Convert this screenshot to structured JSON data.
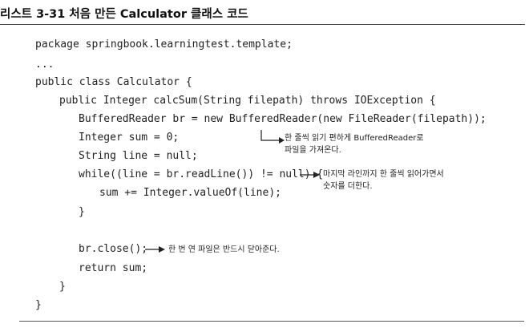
{
  "listing": {
    "title": "리스트 3-31 처음 만든 Calculator 클래스 코드"
  },
  "code": {
    "lines": [
      "package springbook.learningtest.template;",
      "...",
      "public class Calculator {",
      "public Integer calcSum(String filepath) throws IOException {",
      "BufferedReader br = new BufferedReader(new FileReader(filepath));",
      "Integer sum = 0;",
      "String line = null;",
      "while((line = br.readLine()) != null) {",
      "sum += Integer.valueOf(line);",
      "}",
      "br.close();",
      "return sum;",
      "}",
      "}"
    ]
  },
  "annotations": {
    "reader": {
      "line1": "한 줄씩 읽기 편하게 BufferedReader로",
      "line2": "파일을 가져온다."
    },
    "loop": {
      "line1": "마지막 라인까지 한 줄씩 읽어가면서",
      "line2": "숫자를 더한다."
    },
    "close": {
      "line1": "한 번 연 파일은 반드시 닫아준다."
    }
  }
}
